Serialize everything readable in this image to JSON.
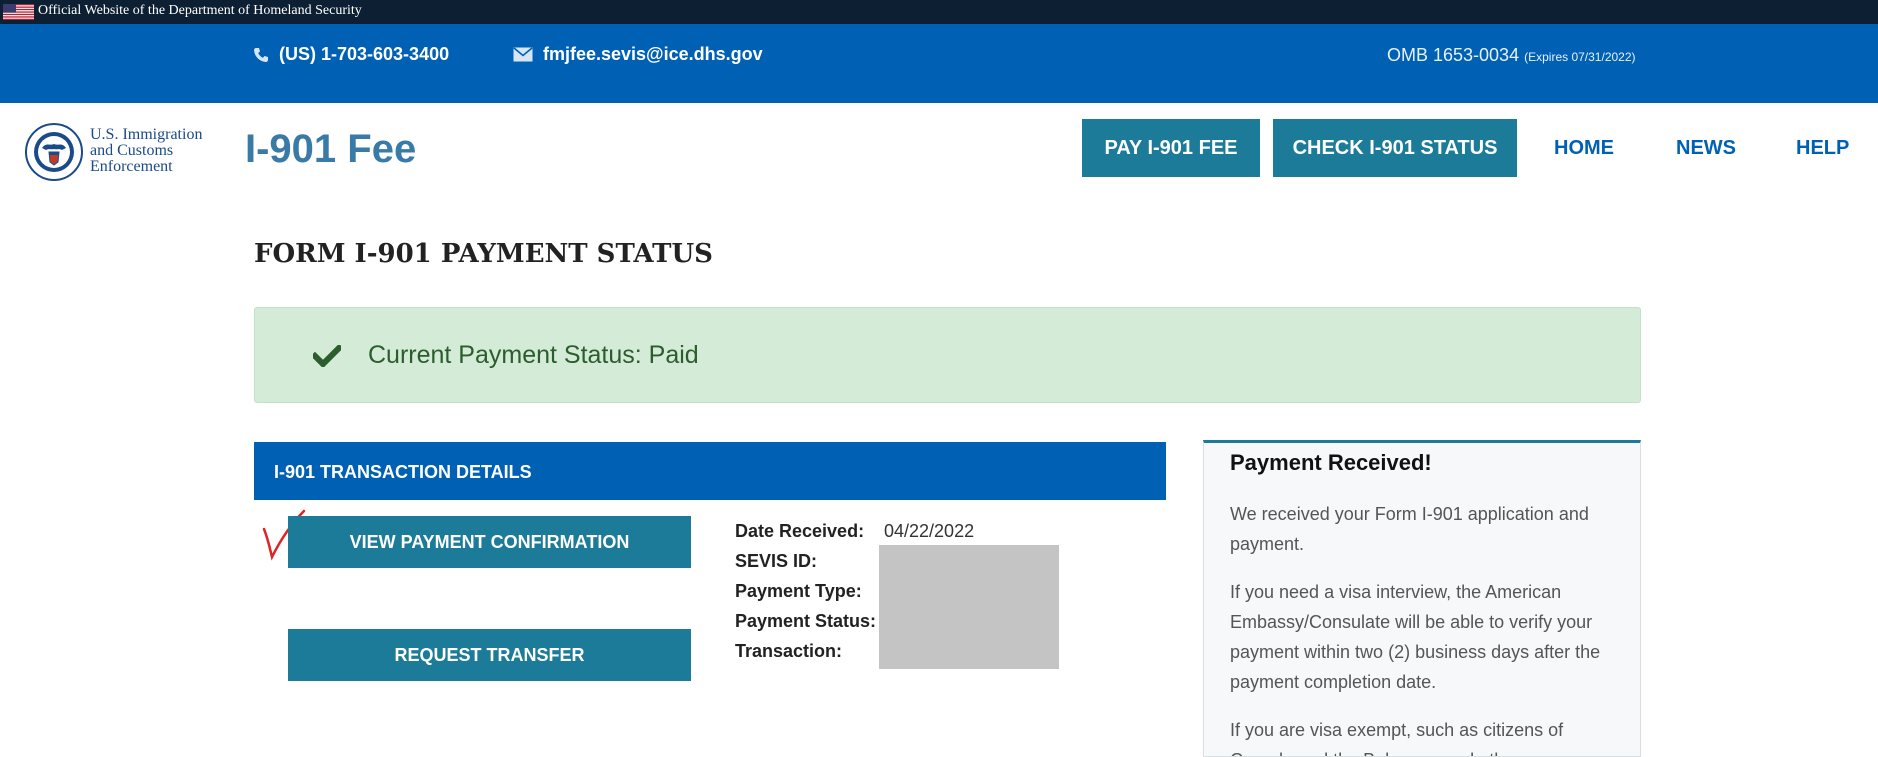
{
  "gov_banner": {
    "text": "Official Website of the Department of Homeland Security"
  },
  "contact": {
    "phone": "(US) 1-703-603-3400",
    "email": "fmjfee.sevis@ice.dhs.gov",
    "omb": "OMB 1653-0034",
    "omb_expires": "(Expires 07/31/2022)"
  },
  "header": {
    "agency_line1": "U.S. Immigration",
    "agency_line2": "and Customs",
    "agency_line3": "Enforcement",
    "brand": "I-901 Fee",
    "nav": {
      "pay": "PAY I-901 FEE",
      "check": "CHECK I-901 STATUS",
      "home": "HOME",
      "news": "NEWS",
      "help": "HELP"
    }
  },
  "main": {
    "title": "FORM I-901 PAYMENT STATUS",
    "status_message": "Current Payment Status: Paid",
    "details_header": "I-901 TRANSACTION DETAILS",
    "buttons": {
      "view_confirmation": "VIEW PAYMENT CONFIRMATION",
      "request_transfer": "REQUEST TRANSFER"
    },
    "fields": {
      "date_received_label": "Date Received:",
      "date_received_value": "04/22/2022",
      "sevis_id_label": "SEVIS ID:",
      "payment_type_label": "Payment Type:",
      "payment_status_label": "Payment Status:",
      "transaction_label": "Transaction:"
    }
  },
  "side_panel": {
    "title": "Payment Received!",
    "p1": "We received your Form I-901 application and payment.",
    "p2": "If you need a visa interview, the American Embassy/Consulate will be able to verify your payment within two (2) business days after the payment completion date.",
    "p3": "If you are visa exempt, such as citizens of Canada and the Bahamas and other persons"
  },
  "colors": {
    "gov_banner_bg": "#0d1f33",
    "primary_blue": "#0061b4",
    "teal_button": "#1b7b98",
    "success_bg": "#d4ebd8",
    "success_text": "#2b5d2d"
  }
}
